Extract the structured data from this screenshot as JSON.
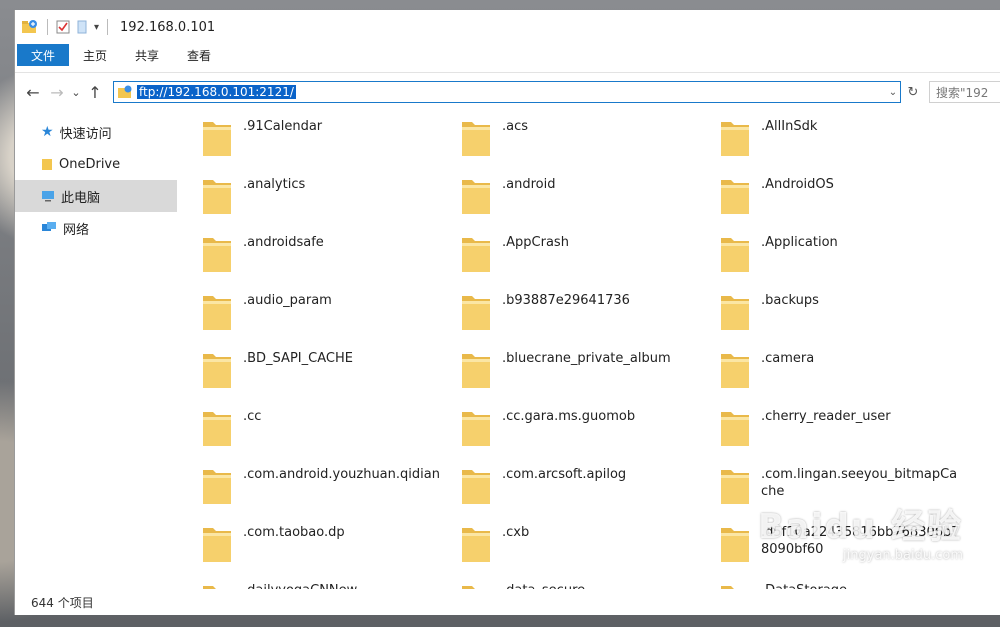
{
  "window": {
    "title": "192.168.0.101"
  },
  "ribbon": {
    "tabs": [
      "文件",
      "主页",
      "共享",
      "查看"
    ]
  },
  "address": {
    "url": "ftp://192.168.0.101:2121/",
    "search_placeholder": "搜索\"192"
  },
  "nav": {
    "items": [
      {
        "label": "快速访问",
        "icon": "star-icon"
      },
      {
        "label": "OneDrive",
        "icon": "folder-icon"
      },
      {
        "label": "此电脑",
        "icon": "computer-icon"
      },
      {
        "label": "网络",
        "icon": "network-icon"
      }
    ]
  },
  "files": [
    ".91Calendar",
    ".acs",
    ".AllInSdk",
    ".analytics",
    ".android",
    ".AndroidOS",
    ".androidsafe",
    ".AppCrash",
    ".Application",
    ".audio_param",
    ".b93887e29641736",
    ".backups",
    ".BD_SAPI_CACHE",
    ".bluecrane_private_album",
    ".camera",
    ".cc",
    ".cc.gara.ms.guomob",
    ".cherry_reader_user",
    ".com.android.youzhuan.qidian",
    ".com.arcsoft.apilog",
    ".com.lingan.seeyou_bitmapCache",
    ".com.taobao.dp",
    ".cxb",
    ".d5f10a22435816bb768306b78090bf60",
    ".dailyyogaCNNew",
    ".data_secure",
    ".DataStorage"
  ],
  "status": {
    "count": "644 个项目"
  },
  "watermark": {
    "brand": "Baidu 经验",
    "url": "jingyan.baidu.com"
  },
  "colors": {
    "accent": "#1979ca",
    "folder": "#f6d06c",
    "selection": "#0a63c9"
  }
}
